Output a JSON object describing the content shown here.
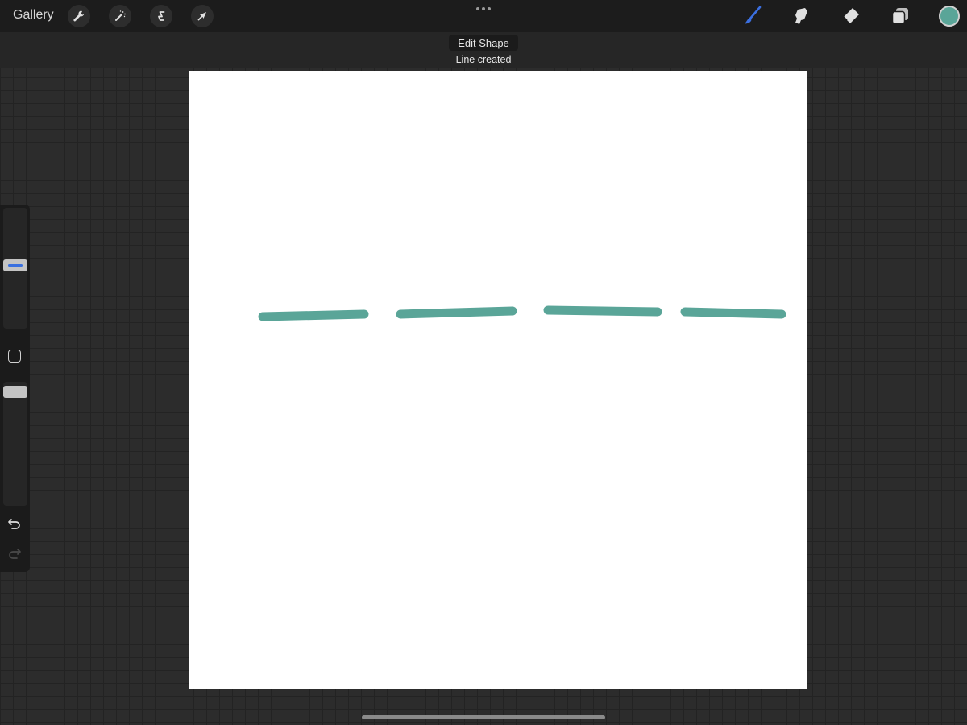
{
  "topbar": {
    "gallery_label": "Gallery",
    "left_tools": [
      "wrench-icon",
      "magic-wand-icon",
      "selection-s-icon",
      "transform-arrow-icon"
    ],
    "right_tools": [
      "brush-icon",
      "smudge-icon",
      "eraser-icon",
      "layers-icon"
    ],
    "active_tool": "brush-icon",
    "current_color": "#5aa598"
  },
  "shape_banner": {
    "button_label": "Edit Shape",
    "status": "Line created"
  },
  "canvas": {
    "background": "#ffffff",
    "stroke_color": "#5aa598"
  },
  "sidebar": {
    "tools": [
      "brush-size-slider",
      "modify-button",
      "opacity-slider",
      "undo-icon",
      "redo-icon"
    ],
    "redo_enabled": false
  }
}
